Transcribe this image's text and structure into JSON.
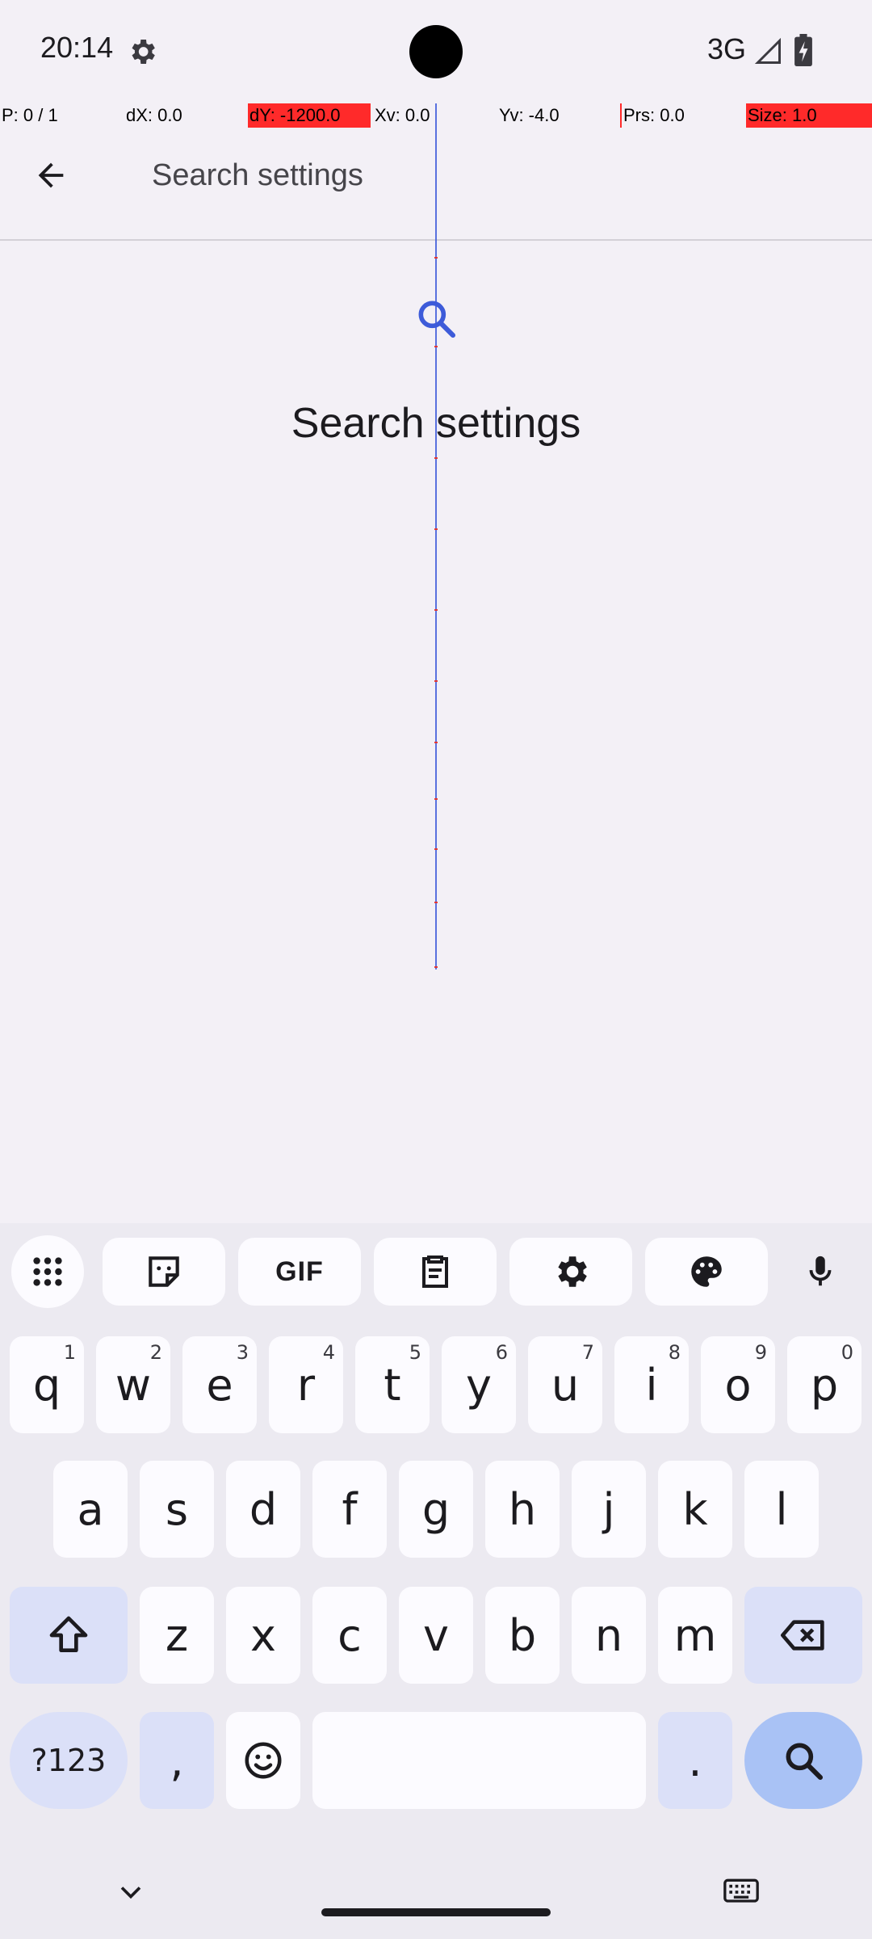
{
  "status": {
    "time": "20:14",
    "network": "3G"
  },
  "debug": {
    "pointer": "P: 0 / 1",
    "dx": "dX: 0.0",
    "dy": "dY: -1200.0",
    "xv": "Xv: 0.0",
    "yv": "Yv: -4.0",
    "prs": "Prs: 0.0",
    "size": "Size: 1.0"
  },
  "app_bar": {
    "search_placeholder": "Search settings"
  },
  "empty_state": {
    "title": "Search settings"
  },
  "keyboard": {
    "gif_label": "GIF",
    "row1": [
      {
        "key": "q",
        "hint": "1"
      },
      {
        "key": "w",
        "hint": "2"
      },
      {
        "key": "e",
        "hint": "3"
      },
      {
        "key": "r",
        "hint": "4"
      },
      {
        "key": "t",
        "hint": "5"
      },
      {
        "key": "y",
        "hint": "6"
      },
      {
        "key": "u",
        "hint": "7"
      },
      {
        "key": "i",
        "hint": "8"
      },
      {
        "key": "o",
        "hint": "9"
      },
      {
        "key": "p",
        "hint": "0"
      }
    ],
    "row2": [
      "a",
      "s",
      "d",
      "f",
      "g",
      "h",
      "j",
      "k",
      "l"
    ],
    "row3": [
      "z",
      "x",
      "c",
      "v",
      "b",
      "n",
      "m"
    ],
    "symbols_label": "?123",
    "comma": ",",
    "period": "."
  },
  "colors": {
    "accent": "#3d5bd9",
    "debug_highlight": "#ff2a2a",
    "keyboard_bg": "#eceaf1",
    "search_key": "#a9c2f5"
  }
}
